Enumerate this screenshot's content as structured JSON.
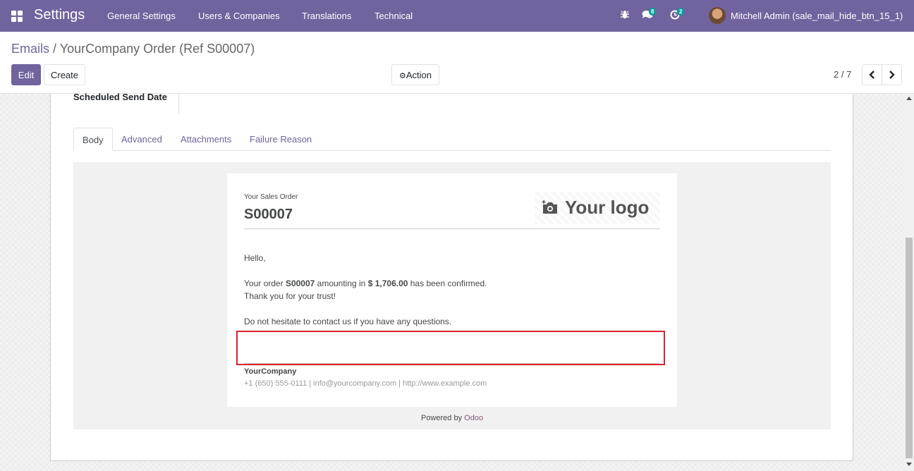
{
  "navbar": {
    "app_name": "Settings",
    "menu": [
      "General Settings",
      "Users & Companies",
      "Translations",
      "Technical"
    ],
    "messages_count": "8",
    "activities_count": "2",
    "user": "Mitchell Admin (sale_mail_hide_btn_15_1)",
    "color": "#71639e"
  },
  "breadcrumb": {
    "parent": "Emails",
    "separator": "/",
    "current": "YourCompany Order (Ref S00007)"
  },
  "buttons": {
    "edit": "Edit",
    "create": "Create",
    "action": "Action"
  },
  "pager": {
    "value": "2 / 7"
  },
  "form": {
    "scheduled_label": "Scheduled Send Date",
    "tabs": [
      "Body",
      "Advanced",
      "Attachments",
      "Failure Reason"
    ]
  },
  "email": {
    "heading_small": "Your Sales Order",
    "order_ref": "S00007",
    "logo": "Your logo",
    "greeting": "Hello,",
    "line1_pre": "Your order ",
    "line1_order": "S00007",
    "line1_mid": " amounting in ",
    "line1_amount": "$ 1,706.00",
    "line1_post": " has been confirmed.",
    "line2": "Thank you for your trust!",
    "line3": "Do not hesitate to contact us if you have any questions.",
    "company": "YourCompany",
    "contact": "+1 (650) 555-0111 | info@yourcompany.com | http://www.example.com",
    "powered_by": "Powered by ",
    "odoo": "Odoo"
  }
}
